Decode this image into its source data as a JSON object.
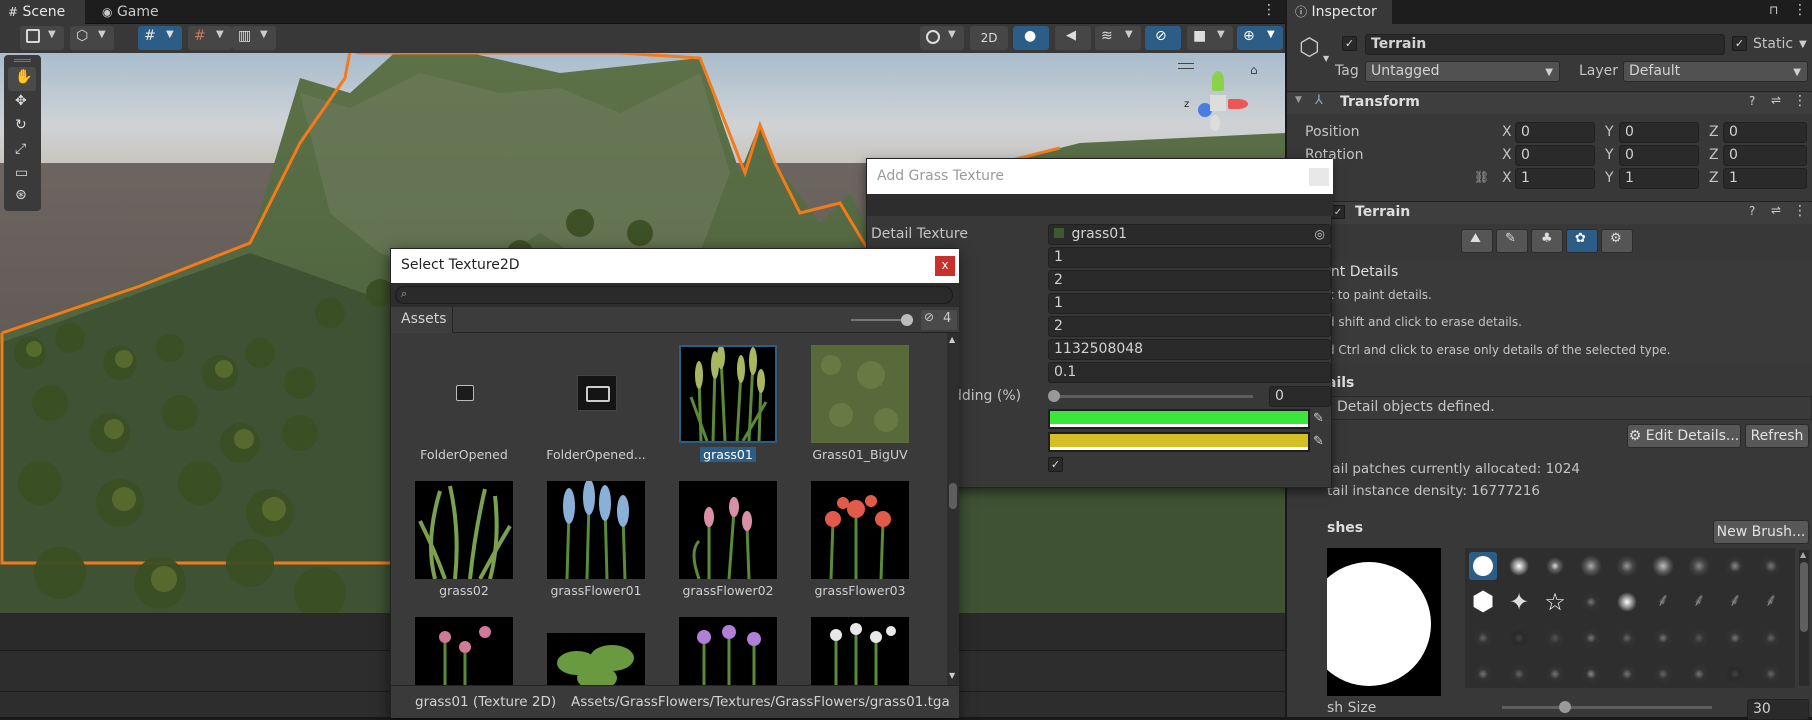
{
  "scene_tabs": {
    "scene": "Scene",
    "game": "Game"
  },
  "scene_toolbar": {
    "twod": "2D"
  },
  "inspector": {
    "tab": "Inspector",
    "object_name": "Terrain",
    "static_label": "Static",
    "tag_label": "Tag",
    "tag_value": "Untagged",
    "layer_label": "Layer",
    "layer_value": "Default",
    "transform": {
      "title": "Transform",
      "position": "Position",
      "rotation": "Rotation",
      "scale": "ale",
      "x": "X",
      "y": "Y",
      "z": "Z",
      "pos": [
        "0",
        "0",
        "0"
      ],
      "rot": [
        "0",
        "0",
        "0"
      ],
      "scl": [
        "1",
        "1",
        "1"
      ]
    },
    "terrain": {
      "title": "Terrain",
      "paint_title": "int Details",
      "hint1": "k to paint details.",
      "hint2": "d shift and click to erase details.",
      "hint3": "d Ctrl and click to erase only details of the selected type.",
      "details_title": "ails",
      "no_details": "Detail objects defined.",
      "edit_details": "Edit Details...",
      "refresh": "Refresh",
      "patches": "tail patches currently allocated: 1024",
      "density": "tail instance density: 16777216",
      "brushes": "shes",
      "new_brush": "New Brush...",
      "brush_size": "sh Size",
      "brush_size_value": "30",
      "brush_size_level": 0.3
    }
  },
  "grass_dialog": {
    "title": "Add Grass Texture",
    "detail_texture_label": "Detail Texture",
    "detail_texture_value": "grass01",
    "values": [
      "1",
      "2",
      "1",
      "2",
      "1132508048",
      "0.1"
    ],
    "padding_label": "dding (%)",
    "padding_value": "0",
    "healthy_color": "#3ae63a",
    "dry_color": "#d4c024",
    "billboard_check": "✓"
  },
  "select_dialog": {
    "title": "Select Texture2D",
    "close": "x",
    "search_placeholder": "",
    "assets_tab": "Assets",
    "hidden_count": "4",
    "items": [
      {
        "label": "FolderOpened"
      },
      {
        "label": "FolderOpened..."
      },
      {
        "label": "grass01"
      },
      {
        "label": "Grass01_BigUV"
      },
      {
        "label": "grass02"
      },
      {
        "label": "grassFlower01"
      },
      {
        "label": "grassFlower02"
      },
      {
        "label": "grassFlower03"
      }
    ],
    "status_name": "grass01 (Texture 2D)",
    "status_path": "Assets/GrassFlowers/Textures/GrassFlowers/grass01.tga"
  },
  "colors": {
    "accent": "#2c5d87",
    "terrain_outline": "#f57a1a",
    "close_red": "#c8302b"
  }
}
